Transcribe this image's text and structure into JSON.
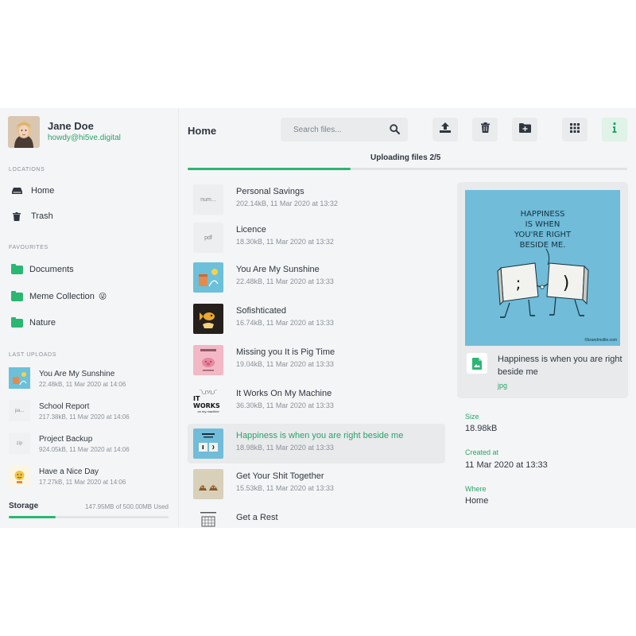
{
  "colors": {
    "accent": "#2ab673",
    "accent_text": "#29a36a",
    "app_background": "#f4f5f6",
    "text": "#2f3640",
    "muted": "#8a9199",
    "preview_background": "#70bcd9"
  },
  "user": {
    "name": "Jane Doe",
    "email": "howdy@hi5ve.digital"
  },
  "sidebar": {
    "locations_label": "LOCATIONS",
    "locations": [
      {
        "label": "Home",
        "icon": "drive-icon"
      },
      {
        "label": "Trash",
        "icon": "trash-icon"
      }
    ],
    "favourites_label": "FAVOURITES",
    "favourites": [
      {
        "label": "Documents",
        "icon": "folder-icon"
      },
      {
        "label": "Meme Collection",
        "icon": "folder-icon",
        "emoji": "😜"
      },
      {
        "label": "Nature",
        "icon": "folder-icon"
      }
    ],
    "last_uploads_label": "LAST UPLOADS",
    "last_uploads": [
      {
        "name": "You Are My Sunshine",
        "meta": "22.48kB, 11 Mar 2020 at 14:06",
        "thumb": ""
      },
      {
        "name": "School Report",
        "meta": "217.38kB, 11 Mar 2020 at 14:06",
        "thumb": "pa..."
      },
      {
        "name": "Project Backup",
        "meta": "924.05kB, 11 Mar 2020 at 14:06",
        "thumb": "zip"
      },
      {
        "name": "Have a Nice Day",
        "meta": "17.27kB, 11 Mar 2020 at 14:06",
        "thumb": ""
      }
    ],
    "storage": {
      "label": "Storage",
      "used_text": "147.95MB of 500.00MB Used",
      "fraction": 0.296
    }
  },
  "main": {
    "title": "Home",
    "search_placeholder": "Search files...",
    "toolbar": [
      {
        "name": "upload-button",
        "icon": "upload-icon"
      },
      {
        "name": "delete-button",
        "icon": "trash-icon"
      },
      {
        "name": "new-folder-button",
        "icon": "folder-plus-icon"
      },
      {
        "name": "grid-view-button",
        "icon": "grid-icon"
      },
      {
        "name": "info-button",
        "icon": "info-icon"
      }
    ],
    "upload_status": "Uploading files 2/5",
    "upload_fraction": 0.37,
    "files": [
      {
        "name": "Personal Savings",
        "meta": "202.14kB, 11 Mar 2020 at 13:32",
        "thumb": "num..."
      },
      {
        "name": "Licence",
        "meta": "18.30kB, 11 Mar 2020 at 13:32",
        "thumb": "pdf"
      },
      {
        "name": "You Are My Sunshine",
        "meta": "22.48kB, 11 Mar 2020 at 13:33",
        "thumb": ""
      },
      {
        "name": "Sofishticated",
        "meta": "16.74kB, 11 Mar 2020 at 13:33",
        "thumb": ""
      },
      {
        "name": "Missing you It is Pig Time",
        "meta": "19.04kB, 11 Mar 2020 at 13:33",
        "thumb": ""
      },
      {
        "name": "It Works On My Machine",
        "meta": "36.30kB, 11 Mar 2020 at 13:33",
        "thumb": "IT WORKS",
        "thumb_top": "¯\\_(ツ)_/¯",
        "thumb_bottom": "on my machine"
      },
      {
        "name": "Happiness is when you are right beside me",
        "meta": "18.98kB, 11 Mar 2020 at 13:33",
        "thumb": "",
        "selected": true
      },
      {
        "name": "Get Your Shit Together",
        "meta": "15.53kB, 11 Mar 2020 at 13:33",
        "thumb": ""
      },
      {
        "name": "Get a Rest",
        "meta": "",
        "thumb": ""
      }
    ]
  },
  "preview": {
    "image_caption_lines": [
      "HAPPINESS",
      "IS WHEN",
      "YOU'RE RIGHT",
      "BESIDE ME."
    ],
    "image_credit": "©lizandmollie.com",
    "key_left": ";",
    "key_right": ")",
    "title": "Happiness is when you are right beside me",
    "extension": "jpg",
    "size_label": "Size",
    "size_value": "18.98kB",
    "created_label": "Created at",
    "created_value": "11 Mar 2020 at 13:33",
    "where_label": "Where",
    "where_value": "Home"
  }
}
